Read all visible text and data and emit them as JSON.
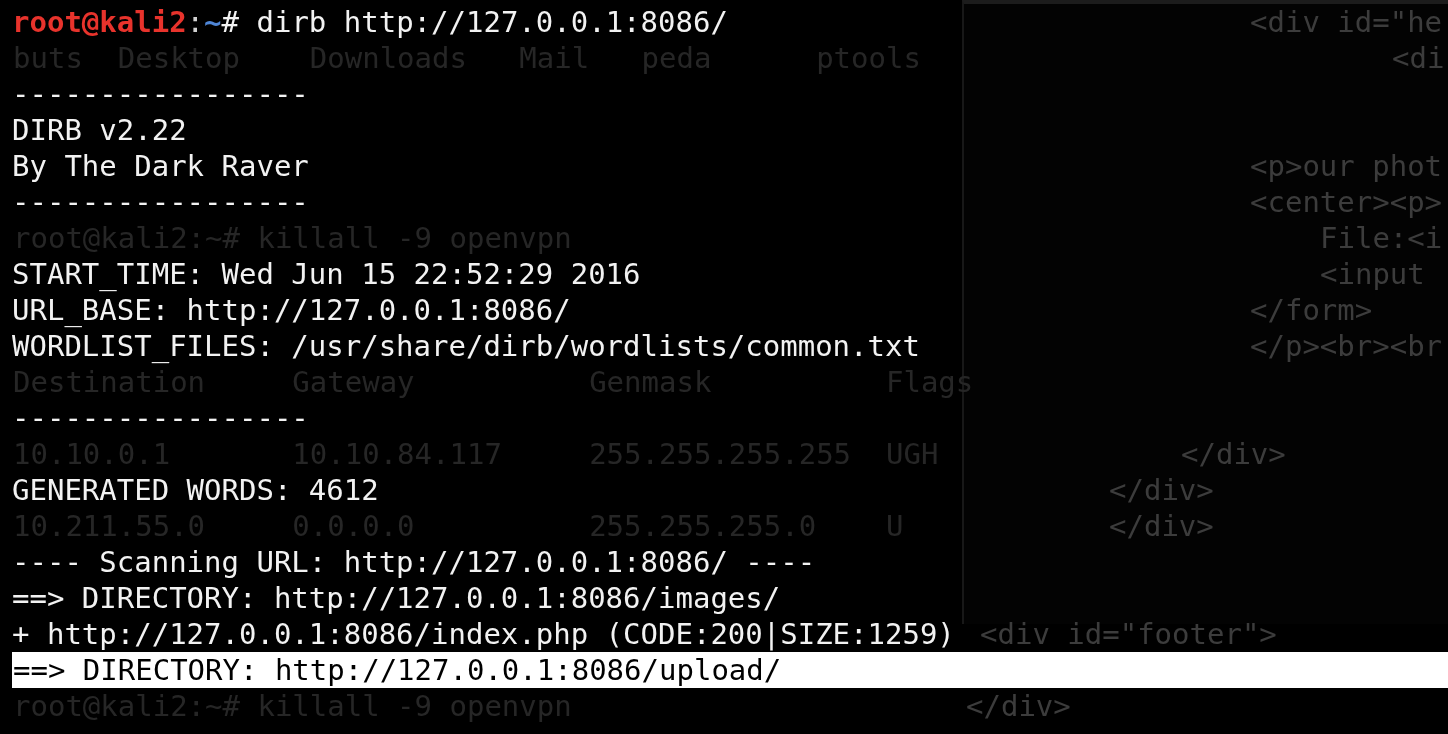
{
  "terminal": {
    "lines": [
      {
        "kind": "prompt",
        "user": "root@kali2",
        "separator": ":",
        "path": "~",
        "symbol": "#",
        "command": "dirb http://127.0.0.1:8086/",
        "editor": "<div id=\"he"
      },
      {
        "kind": "blank",
        "ghost": "buts  Desktop    Downloads   Mail   peda      ptools",
        "editor": "<di"
      },
      {
        "kind": "output",
        "text": "-----------------"
      },
      {
        "kind": "output",
        "text": "DIRB v2.22"
      },
      {
        "kind": "output",
        "text": "By The Dark Raver",
        "editor": "<p>our phot"
      },
      {
        "kind": "output",
        "text": "-----------------",
        "editor": "<center><p>"
      },
      {
        "kind": "blank",
        "ghost": "root@kali2:~# killall -9 openvpn",
        "editor": "File:<i"
      },
      {
        "kind": "output",
        "text": "START_TIME: Wed Jun 15 22:52:29 2016",
        "editor": "<input"
      },
      {
        "kind": "output",
        "text": "URL_BASE: http://127.0.0.1:8086/",
        "editor": "</form>"
      },
      {
        "kind": "output",
        "text": "WORDLIST_FILES: /usr/share/dirb/wordlists/common.txt",
        "editor": "</p><br><br"
      },
      {
        "kind": "blank",
        "ghost": "Destination     Gateway          Genmask          Flags"
      },
      {
        "kind": "output",
        "text": "-----------------"
      },
      {
        "kind": "blank",
        "ghost": "10.10.0.1       10.10.84.117     255.255.255.255  UGH",
        "editor": "</div>"
      },
      {
        "kind": "output",
        "text": "GENERATED WORDS: 4612",
        "editor": "</div>"
      },
      {
        "kind": "blank",
        "ghost": "10.211.55.0     0.0.0.0          255.255.255.0    U",
        "editor": "</div>"
      },
      {
        "kind": "output",
        "text": "---- Scanning URL: http://127.0.0.1:8086/ ----"
      },
      {
        "kind": "output",
        "text": "==> DIRECTORY: http://127.0.0.1:8086/images/"
      },
      {
        "kind": "output",
        "text": "+ http://127.0.0.1:8086/index.php (CODE:200|SIZE:1259)",
        "editor": "<div id=\"footer\">"
      },
      {
        "kind": "output",
        "text": "==> DIRECTORY: http://127.0.0.1:8086/upload/",
        "selected": true
      },
      {
        "kind": "blank",
        "ghost": "root@kali2:~# killall -9 openvpn",
        "editor": "</div>"
      }
    ]
  }
}
